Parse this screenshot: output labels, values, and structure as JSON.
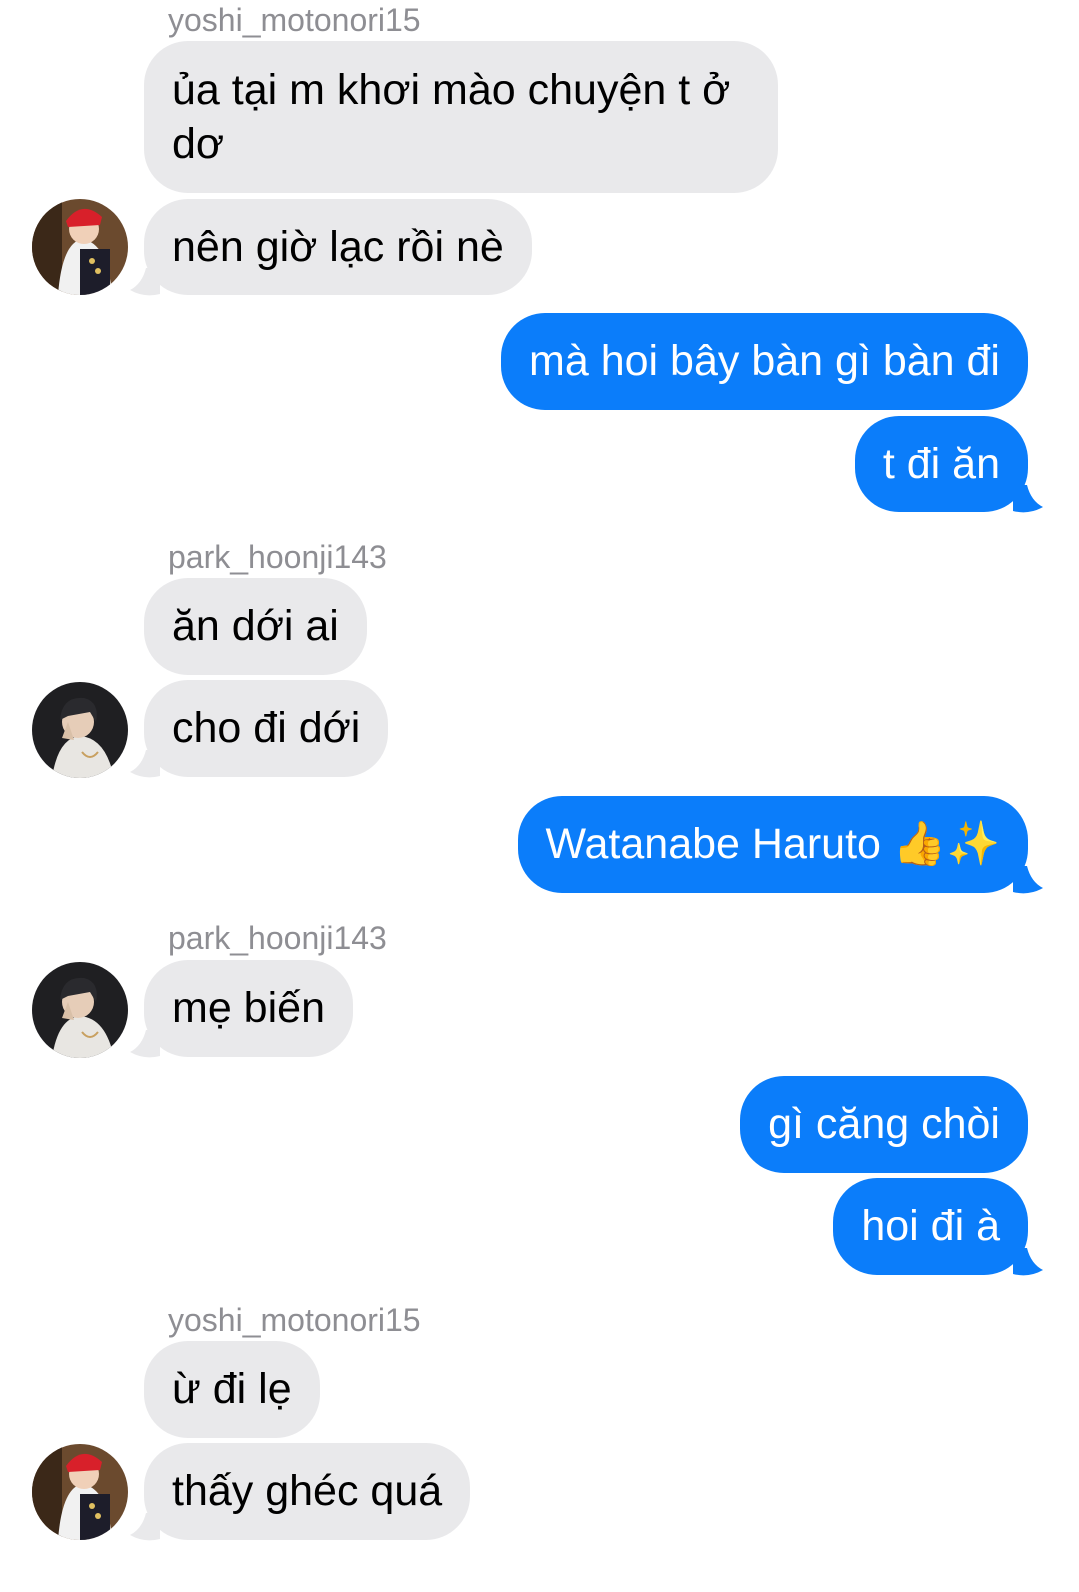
{
  "colors": {
    "incoming_bubble": "#e9e9eb",
    "outgoing_bubble": "#0b7dfa",
    "sender_name": "#8e8e93"
  },
  "messages": [
    {
      "type": "sender",
      "text": "yoshi_motonori15"
    },
    {
      "type": "incoming",
      "text": "ủa tại m khơi mào chuyện t ở dơ"
    },
    {
      "type": "incoming",
      "text": "nên giờ lạc rồi nè",
      "avatar": "avatar-yoshi"
    },
    {
      "type": "outgoing",
      "text": "mà hoi bây bàn gì bàn đi"
    },
    {
      "type": "outgoing",
      "text": "t đi ăn"
    },
    {
      "type": "sender",
      "text": "park_hoonji143"
    },
    {
      "type": "incoming",
      "text": "ăn dới ai"
    },
    {
      "type": "incoming",
      "text": "cho đi dới",
      "avatar": "avatar-park"
    },
    {
      "type": "outgoing",
      "text": "Watanabe Haruto",
      "emoji": "👍✨"
    },
    {
      "type": "sender",
      "text": "park_hoonji143"
    },
    {
      "type": "incoming",
      "text": "mẹ biến",
      "avatar": "avatar-park"
    },
    {
      "type": "outgoing",
      "text": "gì căng chòi"
    },
    {
      "type": "outgoing",
      "text": "hoi đi à"
    },
    {
      "type": "sender",
      "text": "yoshi_motonori15"
    },
    {
      "type": "incoming",
      "text": "ừ đi lẹ"
    },
    {
      "type": "incoming",
      "text": "thấy ghéc quá",
      "avatar": "avatar-yoshi"
    }
  ]
}
